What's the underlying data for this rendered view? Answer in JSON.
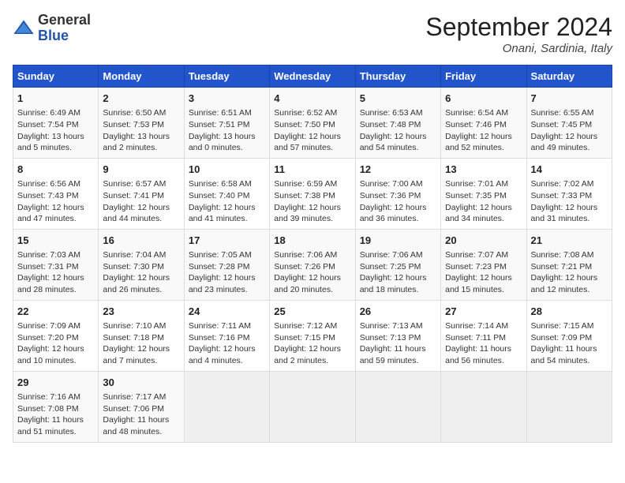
{
  "header": {
    "logo_general": "General",
    "logo_blue": "Blue",
    "month_title": "September 2024",
    "location": "Onani, Sardinia, Italy"
  },
  "columns": [
    "Sunday",
    "Monday",
    "Tuesday",
    "Wednesday",
    "Thursday",
    "Friday",
    "Saturday"
  ],
  "weeks": [
    [
      {
        "day": "1",
        "sunrise": "Sunrise: 6:49 AM",
        "sunset": "Sunset: 7:54 PM",
        "daylight": "Daylight: 13 hours and 5 minutes."
      },
      {
        "day": "2",
        "sunrise": "Sunrise: 6:50 AM",
        "sunset": "Sunset: 7:53 PM",
        "daylight": "Daylight: 13 hours and 2 minutes."
      },
      {
        "day": "3",
        "sunrise": "Sunrise: 6:51 AM",
        "sunset": "Sunset: 7:51 PM",
        "daylight": "Daylight: 13 hours and 0 minutes."
      },
      {
        "day": "4",
        "sunrise": "Sunrise: 6:52 AM",
        "sunset": "Sunset: 7:50 PM",
        "daylight": "Daylight: 12 hours and 57 minutes."
      },
      {
        "day": "5",
        "sunrise": "Sunrise: 6:53 AM",
        "sunset": "Sunset: 7:48 PM",
        "daylight": "Daylight: 12 hours and 54 minutes."
      },
      {
        "day": "6",
        "sunrise": "Sunrise: 6:54 AM",
        "sunset": "Sunset: 7:46 PM",
        "daylight": "Daylight: 12 hours and 52 minutes."
      },
      {
        "day": "7",
        "sunrise": "Sunrise: 6:55 AM",
        "sunset": "Sunset: 7:45 PM",
        "daylight": "Daylight: 12 hours and 49 minutes."
      }
    ],
    [
      {
        "day": "8",
        "sunrise": "Sunrise: 6:56 AM",
        "sunset": "Sunset: 7:43 PM",
        "daylight": "Daylight: 12 hours and 47 minutes."
      },
      {
        "day": "9",
        "sunrise": "Sunrise: 6:57 AM",
        "sunset": "Sunset: 7:41 PM",
        "daylight": "Daylight: 12 hours and 44 minutes."
      },
      {
        "day": "10",
        "sunrise": "Sunrise: 6:58 AM",
        "sunset": "Sunset: 7:40 PM",
        "daylight": "Daylight: 12 hours and 41 minutes."
      },
      {
        "day": "11",
        "sunrise": "Sunrise: 6:59 AM",
        "sunset": "Sunset: 7:38 PM",
        "daylight": "Daylight: 12 hours and 39 minutes."
      },
      {
        "day": "12",
        "sunrise": "Sunrise: 7:00 AM",
        "sunset": "Sunset: 7:36 PM",
        "daylight": "Daylight: 12 hours and 36 minutes."
      },
      {
        "day": "13",
        "sunrise": "Sunrise: 7:01 AM",
        "sunset": "Sunset: 7:35 PM",
        "daylight": "Daylight: 12 hours and 34 minutes."
      },
      {
        "day": "14",
        "sunrise": "Sunrise: 7:02 AM",
        "sunset": "Sunset: 7:33 PM",
        "daylight": "Daylight: 12 hours and 31 minutes."
      }
    ],
    [
      {
        "day": "15",
        "sunrise": "Sunrise: 7:03 AM",
        "sunset": "Sunset: 7:31 PM",
        "daylight": "Daylight: 12 hours and 28 minutes."
      },
      {
        "day": "16",
        "sunrise": "Sunrise: 7:04 AM",
        "sunset": "Sunset: 7:30 PM",
        "daylight": "Daylight: 12 hours and 26 minutes."
      },
      {
        "day": "17",
        "sunrise": "Sunrise: 7:05 AM",
        "sunset": "Sunset: 7:28 PM",
        "daylight": "Daylight: 12 hours and 23 minutes."
      },
      {
        "day": "18",
        "sunrise": "Sunrise: 7:06 AM",
        "sunset": "Sunset: 7:26 PM",
        "daylight": "Daylight: 12 hours and 20 minutes."
      },
      {
        "day": "19",
        "sunrise": "Sunrise: 7:06 AM",
        "sunset": "Sunset: 7:25 PM",
        "daylight": "Daylight: 12 hours and 18 minutes."
      },
      {
        "day": "20",
        "sunrise": "Sunrise: 7:07 AM",
        "sunset": "Sunset: 7:23 PM",
        "daylight": "Daylight: 12 hours and 15 minutes."
      },
      {
        "day": "21",
        "sunrise": "Sunrise: 7:08 AM",
        "sunset": "Sunset: 7:21 PM",
        "daylight": "Daylight: 12 hours and 12 minutes."
      }
    ],
    [
      {
        "day": "22",
        "sunrise": "Sunrise: 7:09 AM",
        "sunset": "Sunset: 7:20 PM",
        "daylight": "Daylight: 12 hours and 10 minutes."
      },
      {
        "day": "23",
        "sunrise": "Sunrise: 7:10 AM",
        "sunset": "Sunset: 7:18 PM",
        "daylight": "Daylight: 12 hours and 7 minutes."
      },
      {
        "day": "24",
        "sunrise": "Sunrise: 7:11 AM",
        "sunset": "Sunset: 7:16 PM",
        "daylight": "Daylight: 12 hours and 4 minutes."
      },
      {
        "day": "25",
        "sunrise": "Sunrise: 7:12 AM",
        "sunset": "Sunset: 7:15 PM",
        "daylight": "Daylight: 12 hours and 2 minutes."
      },
      {
        "day": "26",
        "sunrise": "Sunrise: 7:13 AM",
        "sunset": "Sunset: 7:13 PM",
        "daylight": "Daylight: 11 hours and 59 minutes."
      },
      {
        "day": "27",
        "sunrise": "Sunrise: 7:14 AM",
        "sunset": "Sunset: 7:11 PM",
        "daylight": "Daylight: 11 hours and 56 minutes."
      },
      {
        "day": "28",
        "sunrise": "Sunrise: 7:15 AM",
        "sunset": "Sunset: 7:09 PM",
        "daylight": "Daylight: 11 hours and 54 minutes."
      }
    ],
    [
      {
        "day": "29",
        "sunrise": "Sunrise: 7:16 AM",
        "sunset": "Sunset: 7:08 PM",
        "daylight": "Daylight: 11 hours and 51 minutes."
      },
      {
        "day": "30",
        "sunrise": "Sunrise: 7:17 AM",
        "sunset": "Sunset: 7:06 PM",
        "daylight": "Daylight: 11 hours and 48 minutes."
      },
      null,
      null,
      null,
      null,
      null
    ]
  ]
}
